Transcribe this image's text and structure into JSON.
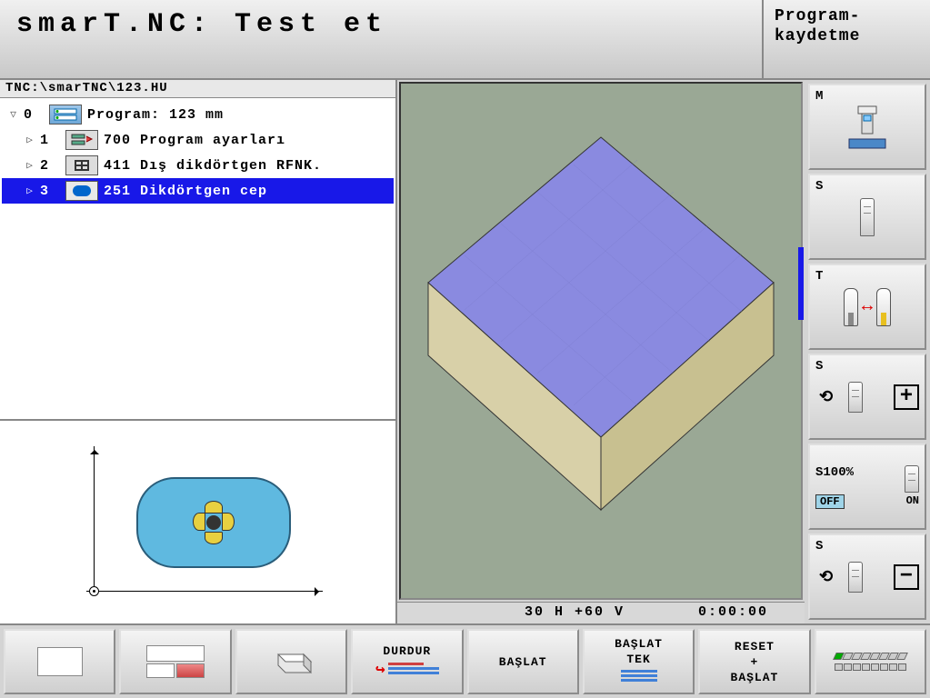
{
  "header": {
    "title": "smarT.NC: Test et",
    "side": "Program-\nkaydetme"
  },
  "path": "TNC:\\smarTNC\\123.HU",
  "tree": [
    {
      "expander": "▽",
      "num": "0",
      "label": "Program: 123 mm",
      "selected": false,
      "icon": "prog"
    },
    {
      "expander": "▷",
      "num": "1",
      "label": "700 Program ayarları",
      "selected": false,
      "icon": "settings"
    },
    {
      "expander": "▷",
      "num": "2",
      "label": "411 Dış dikdörtgen RFNK.",
      "selected": false,
      "icon": "grid"
    },
    {
      "expander": "▷",
      "num": "3",
      "label": "251 Dikdörtgen cep",
      "selected": true,
      "icon": "pocket"
    }
  ],
  "status3d": {
    "view": "30 H +60 V",
    "time": "0:00:00"
  },
  "rightButtons": [
    {
      "label": "M",
      "type": "mill"
    },
    {
      "label": "S",
      "type": "spindle"
    },
    {
      "label": "T",
      "type": "toolswap"
    },
    {
      "label": "S",
      "type": "plus"
    },
    {
      "label": "S100%",
      "type": "s100",
      "off": "OFF",
      "on": "ON"
    },
    {
      "label": "S",
      "type": "minus"
    }
  ],
  "softkeys": [
    {
      "type": "rect",
      "label": ""
    },
    {
      "type": "split",
      "label": ""
    },
    {
      "type": "box3d",
      "label": ""
    },
    {
      "type": "durdur",
      "label": "DURDUR"
    },
    {
      "type": "text",
      "label": "BAŞLAT"
    },
    {
      "type": "baslat-tek",
      "label1": "BAŞLAT",
      "label2": "TEK"
    },
    {
      "type": "text3",
      "label1": "RESET",
      "label2": "+",
      "label3": "BAŞLAT"
    },
    {
      "type": "boxes",
      "label": ""
    }
  ]
}
